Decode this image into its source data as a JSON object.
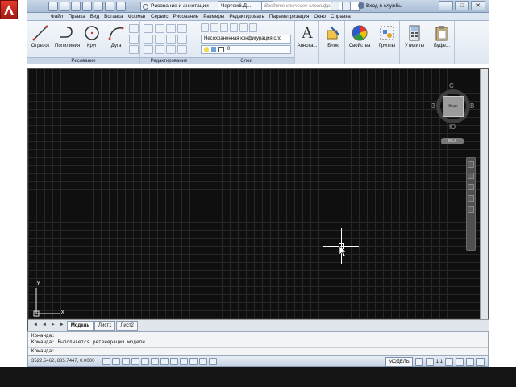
{
  "title_bar": {
    "workspace": "Рисование и аннотации",
    "document_title": "Чертеж6.Д...",
    "search_placeholder": "Введите ключевое слово/фразу",
    "signin_label": "Вход в службы"
  },
  "window_controls": {
    "minimize": "–",
    "maximize": "□",
    "close": "✕"
  },
  "menu": {
    "items": [
      "Файл",
      "Правка",
      "Вид",
      "Вставка",
      "Формат",
      "Сервис",
      "Рисование",
      "Размеры",
      "Редактировать",
      "Параметризация",
      "Окно",
      "Справка"
    ]
  },
  "ribbon": {
    "draw": {
      "title": "Рисование",
      "buttons": [
        "Отрезок",
        "Полилиния",
        "Круг",
        "Дуга"
      ]
    },
    "modify": {
      "title": "Редактирование"
    },
    "layers": {
      "title": "Слои",
      "state": "Несохраненная конфигурация сло",
      "current": "0"
    },
    "annotation": {
      "label": "Аннота..."
    },
    "block": {
      "label": "Блок"
    },
    "properties": {
      "label": "Свойства"
    },
    "groups": {
      "label": "Группы"
    },
    "utilities": {
      "label": "Утилиты"
    },
    "clipboard": {
      "label": "Буфе..."
    }
  },
  "viewcube": {
    "north": "С",
    "south": "Ю",
    "west": "З",
    "east": "В",
    "face": "Верх",
    "wcs": "МСК"
  },
  "ucs": {
    "x": "X",
    "y": "Y"
  },
  "layout_tabs": {
    "nav": [
      "◄",
      "◄",
      "►",
      "►"
    ],
    "tabs": [
      "Модель",
      "Лист1",
      "Лист2"
    ],
    "active": "Модель"
  },
  "command_line": {
    "history": [
      "Команда:",
      "Команда:  Выполняется регенерация модели."
    ],
    "prompt": "Команда:"
  },
  "status_bar": {
    "coordinates": "3522.5462, 885.7447, 0.0000",
    "model_label": "МОДЕЛЬ",
    "annotation_scale": "1:1"
  },
  "colors": {
    "canvas_background": "#0f0f0f",
    "app_logo": "#d1261a",
    "ribbon_background": "#e6edf5"
  }
}
